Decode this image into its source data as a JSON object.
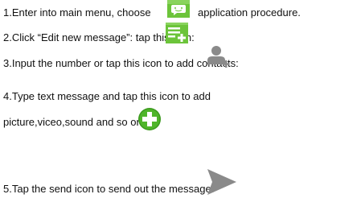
{
  "steps": {
    "s1a": "1.Enter into main menu, choose",
    "s1b": "application procedure.",
    "s2": "2.Click “Edit new message”: tap this icon:",
    "s3": "3.Input the number or tap this icon to add contacts:",
    "s4a": "4.Type text message and tap this icon to add",
    "s4b": "picture,viceo,sound and so on:",
    "s5": "5.Tap the send icon to send out the message:"
  },
  "icons": {
    "messaging": "messaging-app-icon",
    "edit": "edit-new-message-icon",
    "contact": "add-contact-icon",
    "attach": "add-attachment-icon",
    "send": "send-icon"
  },
  "colors": {
    "green": "#6cc43a",
    "dark_green": "#3c9a1e",
    "gray": "#8a8a8a"
  }
}
